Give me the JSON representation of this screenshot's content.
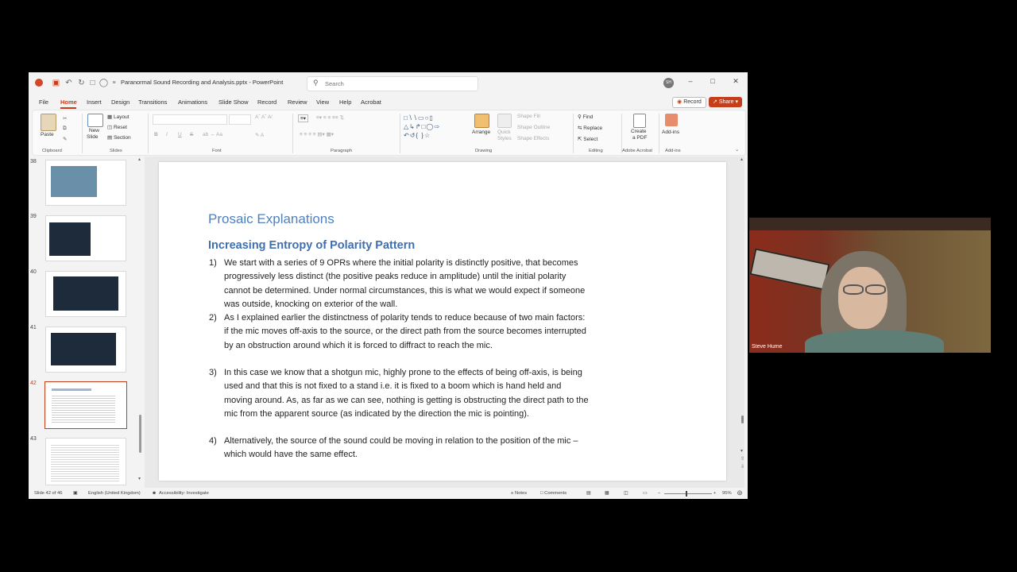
{
  "window": {
    "title": "Paranormal Sound Recording and Analysis.pptx  -  PowerPoint",
    "search_placeholder": "Search",
    "avatar_initials": "SH"
  },
  "menu": {
    "items": [
      "File",
      "Home",
      "Insert",
      "Design",
      "Transitions",
      "Animations",
      "Slide Show",
      "Record",
      "Review",
      "View",
      "Help",
      "Acrobat"
    ],
    "active": "Home",
    "record_label": "Record",
    "share_label": "Share"
  },
  "ribbon": {
    "clipboard": {
      "paste": "Paste",
      "group": "Clipboard"
    },
    "slides": {
      "new_slide_1": "New",
      "new_slide_2": "Slide",
      "layout": "Layout",
      "reset": "Reset",
      "section": "Section",
      "group": "Slides"
    },
    "font": {
      "bold": "B",
      "italic": "I",
      "underline": "U",
      "strike": "S",
      "group": "Font"
    },
    "paragraph": {
      "group": "Paragraph"
    },
    "drawing": {
      "arrange": "Arrange",
      "quick_styles_1": "Quick",
      "quick_styles_2": "Styles",
      "shape_fill": "Shape Fill",
      "shape_outline": "Shape Outline",
      "shape_effects": "Shape Effects",
      "group": "Drawing"
    },
    "editing": {
      "find": "Find",
      "replace": "Replace",
      "select": "Select",
      "group": "Editing"
    },
    "acrobat": {
      "create_pdf_1": "Create",
      "create_pdf_2": "a PDF",
      "group": "Adobe Acrobat"
    },
    "addins": {
      "label": "Add-ins",
      "group": "Add-ins"
    }
  },
  "thumbnails": {
    "numbers": [
      "38",
      "39",
      "40",
      "41",
      "42",
      "43"
    ],
    "selected": "42"
  },
  "slide": {
    "heading": "Prosaic Explanations",
    "subheading": "Increasing Entropy of Polarity Pattern",
    "items": [
      {
        "num": "1)",
        "text": "We start with a series of 9 OPRs where the initial polarity is distinctly positive, that becomes progressively less distinct (the positive peaks reduce in amplitude) until the initial polarity cannot be determined.  Under normal circumstances, this is what we would expect if someone was outside, knocking on exterior of the wall."
      },
      {
        "num": "2)",
        "text": "As I explained earlier the distinctness of polarity tends to reduce because of two main factors:  if the mic moves off-axis to the source, or the direct path from the source becomes interrupted by an obstruction around which it is forced to diffract to reach the mic."
      },
      {
        "num": "3)",
        "text": "In this case we know that a shotgun mic, highly prone to the effects of being off-axis, is being used and that this is not fixed to a stand i.e. it is fixed to a boom which is hand held and moving around.  As, as far as we can see, nothing is getting is obstructing the direct path to the mic from the apparent source (as indicated by the direction the mic is pointing)."
      },
      {
        "num": "4)",
        "text": "Alternatively, the source of the sound could be moving in relation to the position of the mic – which would have the same effect."
      }
    ]
  },
  "status": {
    "slide_counter": "Slide 42 of 46",
    "language": "English (United Kingdom)",
    "accessibility": "Accessibility: Investigate",
    "notes": "Notes",
    "comments": "Comments",
    "zoom": "95%"
  },
  "webcam": {
    "name": "Steve Hume"
  },
  "colors": {
    "accent": "#c43e1c",
    "heading": "#4f81bd",
    "subheading": "#3f6fae"
  }
}
